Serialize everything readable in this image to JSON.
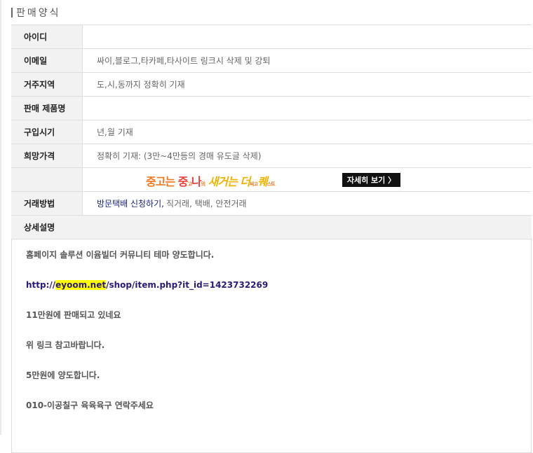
{
  "section_title": "판매양식",
  "rows": [
    {
      "label": "아이디",
      "value": ""
    },
    {
      "label": "이메일",
      "value": "싸이,블로그,타카페,타사이트 링크시 삭제 및 강퇴"
    },
    {
      "label": "거주지역",
      "value": "도,시,동까지 정확히 기재"
    },
    {
      "label": "판매 제품명",
      "value": ""
    },
    {
      "label": "구입시기",
      "value": "년,월 기재"
    },
    {
      "label": "희망가격",
      "value": "정확히 기재: (3만~4만등의 경매 유도글 삭제)"
    }
  ],
  "banner": {
    "part1": "중고는 ",
    "part2": "중",
    "part3": "고",
    "part4": "나",
    "part5": "의",
    "part6": " 새거는 ",
    "part7": "더",
    "part8": "싸고",
    "part9": "퀘",
    "part10": "스트",
    "button_label": "자세히 보기 〉"
  },
  "trade": {
    "label": "거래방법",
    "link": "방문택배 신청하기,",
    "rest": " 직거래,  택배,   안전거래"
  },
  "description": {
    "label": "상세설명",
    "line1": "홈페이지 솔루션 이윰빌더 커뮤니티 테마 양도합니다.",
    "url_prefix": "http://",
    "url_highlight": "eyoom.net",
    "url_suffix": "/shop/item.php?it_id=1423732269",
    "line3": "11만원에 판매되고 있네요",
    "line4": "위 링크 참고바랍니다.",
    "line5": "5만원에 양도합니다.",
    "line6": "010-이공칠구 육육육구 연락주세요"
  }
}
